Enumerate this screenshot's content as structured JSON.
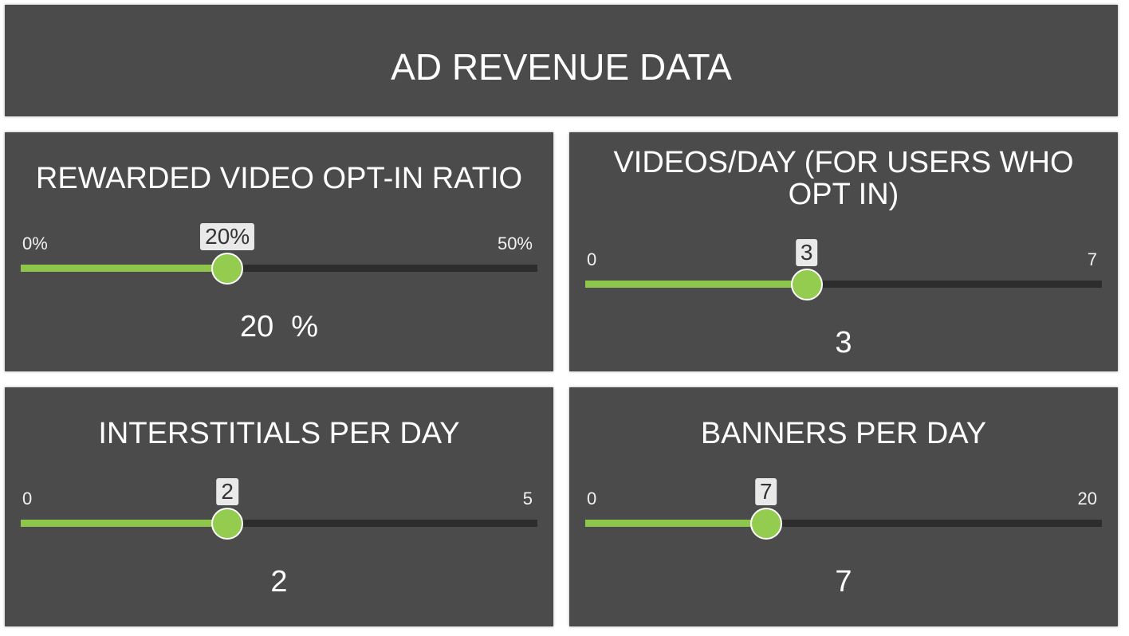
{
  "header": {
    "title": "AD REVENUE DATA"
  },
  "colors": {
    "panel_bg": "#4b4b4b",
    "track": "#2d2d2d",
    "fill": "#8dc64a",
    "knob": "#93cc4f",
    "bubble_bg": "#e9e9e9",
    "text": "#ffffff"
  },
  "cards": [
    {
      "title": "REWARDED VIDEO OPT-IN RATIO",
      "slider": {
        "min": 0,
        "max": 50,
        "value": 20,
        "min_label": "0%",
        "max_label": "50%",
        "bubble": "20%"
      },
      "display": {
        "value": "20",
        "unit": "%"
      }
    },
    {
      "title_line1": "VIDEOS/DAY (FOR USERS WHO",
      "title_line2": "OPT IN)",
      "slider": {
        "min": 0,
        "max": 7,
        "value": 3,
        "min_label": "0",
        "max_label": "7",
        "bubble": "3"
      },
      "display": {
        "value": "3"
      }
    },
    {
      "title": "INTERSTITIALS PER DAY",
      "slider": {
        "min": 0,
        "max": 5,
        "value": 2,
        "min_label": "0",
        "max_label": "5",
        "bubble": "2"
      },
      "display": {
        "value": "2"
      }
    },
    {
      "title": "BANNERS PER DAY",
      "slider": {
        "min": 0,
        "max": 20,
        "value": 7,
        "min_label": "0",
        "max_label": "20",
        "bubble": "7"
      },
      "display": {
        "value": "7"
      }
    }
  ]
}
